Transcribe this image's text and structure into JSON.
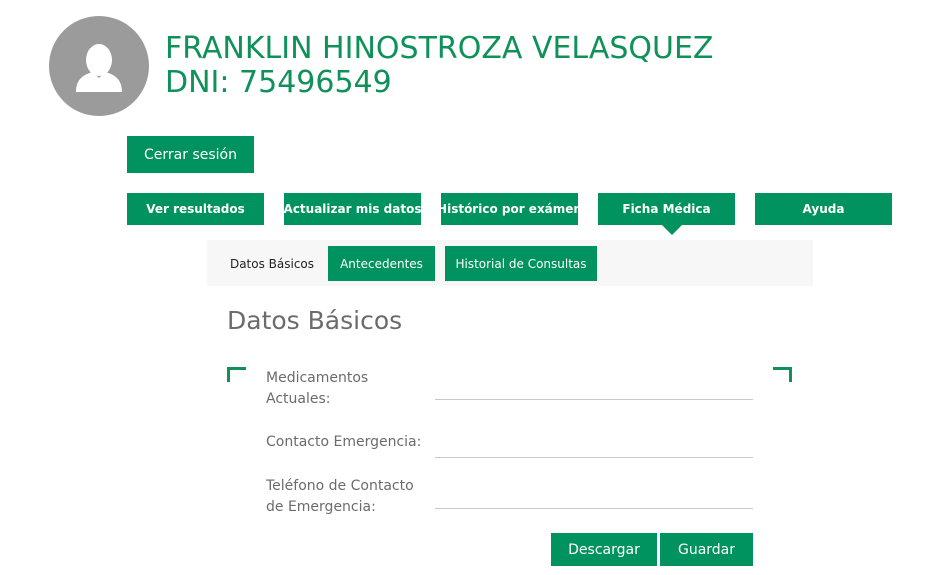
{
  "user": {
    "name": "FRANKLIN HINOSTROZA VELASQUEZ",
    "dni": "DNI: 75496549",
    "avatar_icon": "user-silhouette-icon"
  },
  "session": {
    "logout_label": "Cerrar sesión"
  },
  "nav": {
    "items": [
      {
        "label": "Ver resultados"
      },
      {
        "label": "Actualizar mis datos"
      },
      {
        "label": "Histórico por exámen"
      },
      {
        "label": "Ficha Médica",
        "active": true
      },
      {
        "label": "Ayuda"
      }
    ]
  },
  "subtabs": {
    "items": [
      {
        "label": "Datos Básicos",
        "active": true
      },
      {
        "label": "Antecedentes"
      },
      {
        "label": "Historial de Consultas"
      }
    ]
  },
  "form": {
    "title": "Datos Básicos",
    "fields": [
      {
        "label": "Medicamentos Actuales:",
        "value": ""
      },
      {
        "label": "Contacto Emergencia:",
        "value": ""
      },
      {
        "label": "Teléfono de Contacto de Emergencia:",
        "value": ""
      }
    ],
    "download_label": "Descargar",
    "save_label": "Guardar"
  },
  "colors": {
    "brand_green": "#009360",
    "title_green": "#0f9159",
    "avatar_gray": "#9b9b9b"
  }
}
